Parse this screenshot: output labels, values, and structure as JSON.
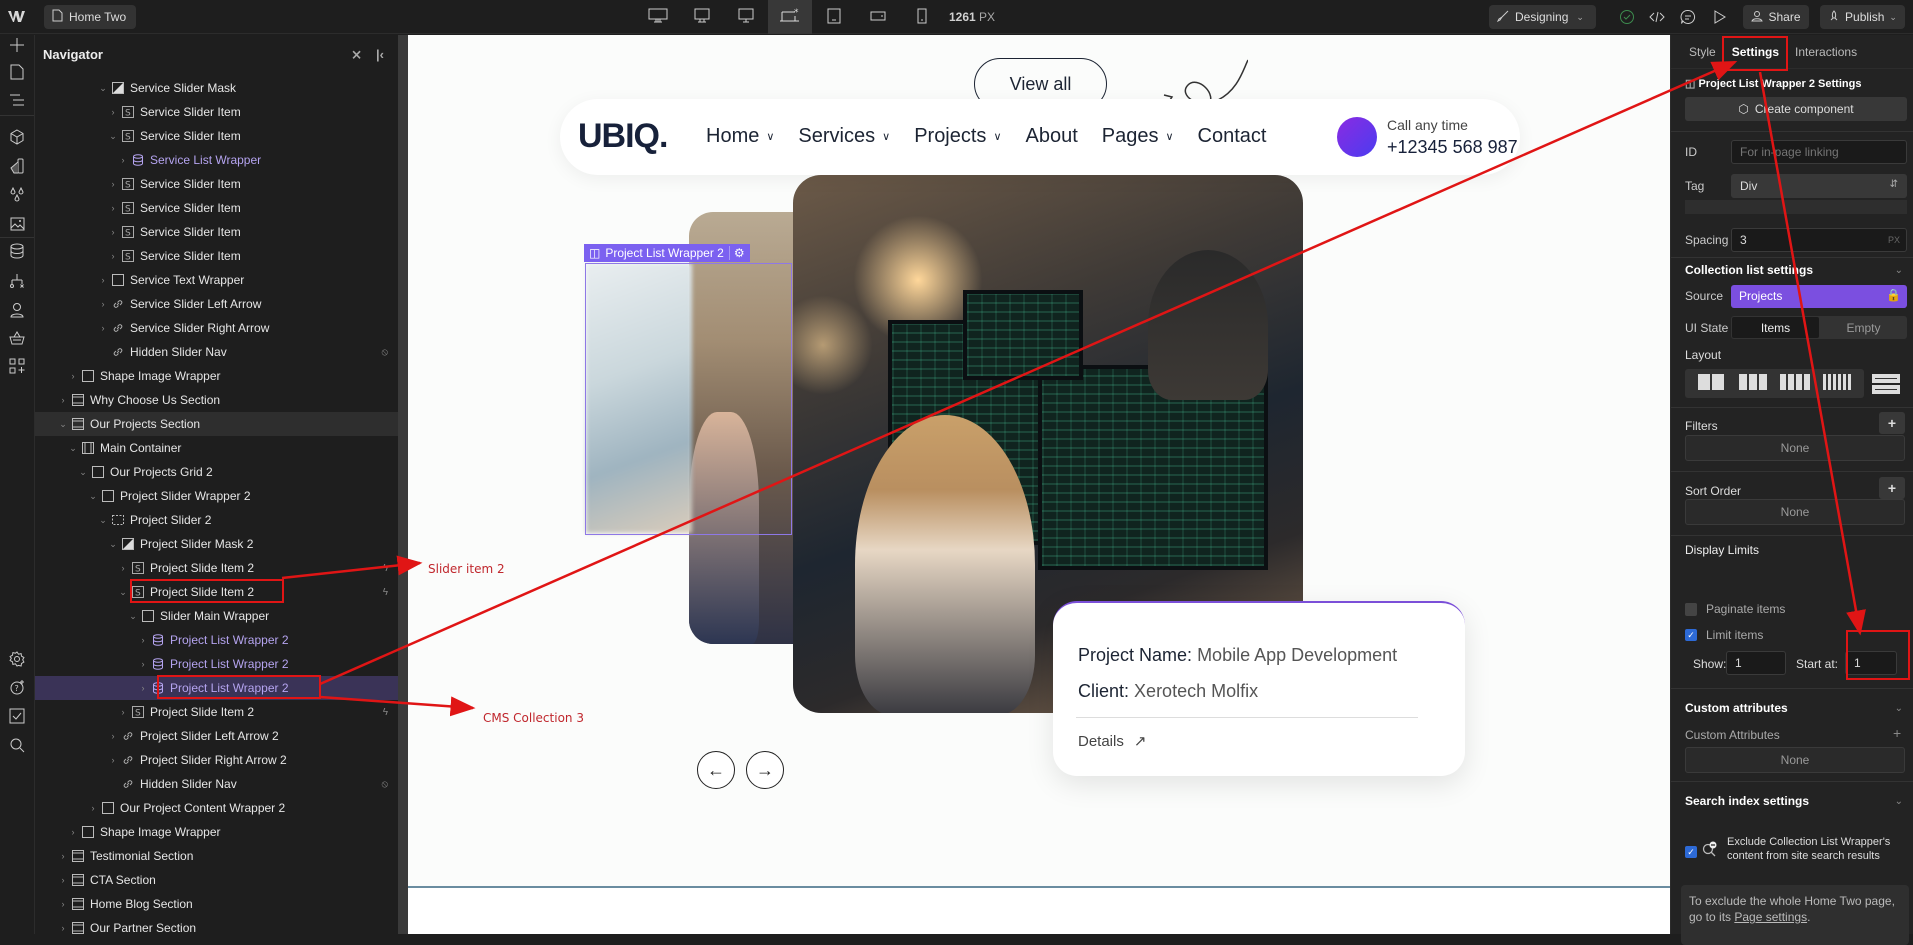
{
  "topbar": {
    "page_name": "Home Two",
    "breakpoint_width": "1261",
    "breakpoint_unit": "PX",
    "mode_label": "Designing",
    "share_label": "Share",
    "publish_label": "Publish",
    "breakpoints": [
      "desktop-xxl",
      "desktop-xl",
      "desktop-l",
      "desktop-base",
      "tablet",
      "mobile-landscape",
      "mobile-portrait"
    ]
  },
  "navigator": {
    "title": "Navigator",
    "rows": [
      {
        "label": "Service Slider Mask",
        "icon": "slider-mask-icon",
        "indent": 7,
        "caret": "down"
      },
      {
        "label": "Service Slider Item",
        "icon": "slide-icon",
        "indent": 8,
        "caret": "right"
      },
      {
        "label": "Service Slider Item",
        "icon": "slide-icon",
        "indent": 8,
        "caret": "down"
      },
      {
        "label": "Service List Wrapper",
        "icon": "cms-icon",
        "indent": 9,
        "caret": "right",
        "cms": true
      },
      {
        "label": "Service Slider Item",
        "icon": "slide-icon",
        "indent": 8,
        "caret": "right"
      },
      {
        "label": "Service Slider Item",
        "icon": "slide-icon",
        "indent": 8,
        "caret": "right"
      },
      {
        "label": "Service Slider Item",
        "icon": "slide-icon",
        "indent": 8,
        "caret": "right"
      },
      {
        "label": "Service Slider Item",
        "icon": "slide-icon",
        "indent": 8,
        "caret": "right"
      },
      {
        "label": "Service Text Wrapper",
        "icon": "box-icon",
        "indent": 7,
        "caret": "right"
      },
      {
        "label": "Service Slider Left Arrow",
        "icon": "link-icon",
        "indent": 7,
        "caret": "right"
      },
      {
        "label": "Service Slider Right Arrow",
        "icon": "link-icon",
        "indent": 7,
        "caret": "right"
      },
      {
        "label": "Hidden Slider Nav",
        "icon": "link-icon",
        "indent": 7,
        "caret": "none",
        "right_icon": "hidden"
      },
      {
        "label": "Shape Image Wrapper",
        "icon": "box-icon",
        "indent": 4,
        "caret": "right"
      },
      {
        "label": "Why Choose Us Section",
        "icon": "section-icon",
        "indent": 3,
        "caret": "right"
      },
      {
        "label": "Our Projects Section",
        "icon": "section-icon",
        "indent": 3,
        "caret": "down",
        "hl": true
      },
      {
        "label": "Main Container",
        "icon": "container-icon",
        "indent": 4,
        "caret": "down"
      },
      {
        "label": "Our Projects Grid 2",
        "icon": "box-icon",
        "indent": 5,
        "caret": "down"
      },
      {
        "label": "Project Slider Wrapper 2",
        "icon": "box-icon",
        "indent": 6,
        "caret": "down"
      },
      {
        "label": "Project Slider 2",
        "icon": "slider-icon",
        "indent": 7,
        "caret": "down"
      },
      {
        "label": "Project Slider Mask 2",
        "icon": "slider-mask-icon",
        "indent": 8,
        "caret": "down"
      },
      {
        "label": "Project Slide Item 2",
        "icon": "slide-icon",
        "indent": 9,
        "caret": "right",
        "right_icon": "bolt"
      },
      {
        "label": "Project Slide Item 2",
        "icon": "slide-icon",
        "indent": 9,
        "caret": "down",
        "right_icon": "bolt",
        "boxed": true
      },
      {
        "label": "Slider Main Wrapper",
        "icon": "box-icon",
        "indent": 10,
        "caret": "down"
      },
      {
        "label": "Project List Wrapper 2",
        "icon": "cms-icon",
        "indent": 11,
        "caret": "right",
        "cms": true
      },
      {
        "label": "Project List Wrapper 2",
        "icon": "cms-icon",
        "indent": 11,
        "caret": "right",
        "cms": true
      },
      {
        "label": "Project List Wrapper 2",
        "icon": "cms-icon",
        "indent": 11,
        "caret": "right",
        "cms": true,
        "selected": true,
        "boxed": true
      },
      {
        "label": "Project Slide Item 2",
        "icon": "slide-icon",
        "indent": 9,
        "caret": "right",
        "right_icon": "bolt"
      },
      {
        "label": "Project Slider Left Arrow 2",
        "icon": "link-icon",
        "indent": 8,
        "caret": "right"
      },
      {
        "label": "Project Slider Right Arrow 2",
        "icon": "link-icon",
        "indent": 8,
        "caret": "right"
      },
      {
        "label": "Hidden Slider Nav",
        "icon": "link-icon",
        "indent": 8,
        "caret": "none",
        "right_icon": "hidden"
      },
      {
        "label": "Our Project Content Wrapper 2",
        "icon": "box-icon",
        "indent": 6,
        "caret": "right"
      },
      {
        "label": "Shape Image Wrapper",
        "icon": "box-icon",
        "indent": 4,
        "caret": "right"
      },
      {
        "label": "Testimonial Section",
        "icon": "section-icon",
        "indent": 3,
        "caret": "right"
      },
      {
        "label": "CTA Section",
        "icon": "section-icon",
        "indent": 3,
        "caret": "right"
      },
      {
        "label": "Home Blog Section",
        "icon": "section-icon",
        "indent": 3,
        "caret": "right"
      },
      {
        "label": "Our Partner Section",
        "icon": "section-icon",
        "indent": 3,
        "caret": "right"
      }
    ]
  },
  "canvas": {
    "view_all": "View all",
    "logo": "UBIQ.",
    "menu": [
      {
        "label": "Home",
        "dropdown": true
      },
      {
        "label": "Services",
        "dropdown": true
      },
      {
        "label": "Projects",
        "dropdown": true
      },
      {
        "label": "About",
        "dropdown": false
      },
      {
        "label": "Pages",
        "dropdown": true
      },
      {
        "label": "Contact",
        "dropdown": false
      }
    ],
    "call_label": "Call any time",
    "call_number": "+12345 568 987",
    "selected_tag": "Project List Wrapper 2",
    "card": {
      "name_key": "Project Name:",
      "name_value": "Mobile App Development",
      "client_key": "Client:",
      "client_value": "Xerotech Molfix",
      "details": "Details"
    }
  },
  "settings": {
    "tabs": [
      "Style",
      "Settings",
      "Interactions"
    ],
    "active_tab": "Settings",
    "element_title": "Project List Wrapper 2 Settings",
    "create_component": "Create component",
    "id_label": "ID",
    "id_placeholder": "For in-page linking",
    "tag_label": "Tag",
    "tag_value": "Div",
    "spacing_label": "Spacing",
    "spacing_value": "3",
    "spacing_unit": "PX",
    "collection_title": "Collection list settings",
    "source_label": "Source",
    "source_value": "Projects",
    "ui_state_label": "UI State",
    "ui_state_items": "Items",
    "ui_state_empty": "Empty",
    "layout_label": "Layout",
    "filters_label": "Filters",
    "filters_value": "None",
    "sort_label": "Sort Order",
    "sort_value": "None",
    "display_limits": "Display Limits",
    "paginate_label": "Paginate items",
    "paginate_checked": false,
    "limit_label": "Limit items",
    "limit_checked": true,
    "show_label": "Show:",
    "show_value": "1",
    "start_label": "Start at:",
    "start_value": "1",
    "custom_attr_title": "Custom attributes",
    "custom_attr_label": "Custom Attributes",
    "custom_attr_value": "None",
    "search_title": "Search index settings",
    "search_exclude": "Exclude Collection List Wrapper's content from site search results",
    "search_exclude_checked": true,
    "search_note_prefix": "To exclude the whole Home Two page, go to its ",
    "search_note_link": "Page settings",
    "search_note_suffix": "."
  },
  "annotations": {
    "slider_item": "Slider item 2",
    "cms_collection": "CMS Collection 3"
  },
  "colors": {
    "accent": "#7b61f0",
    "cms_text": "#b5a4f0",
    "annotation_red": "#e01515",
    "checkbox_blue": "#2d6ad6"
  }
}
